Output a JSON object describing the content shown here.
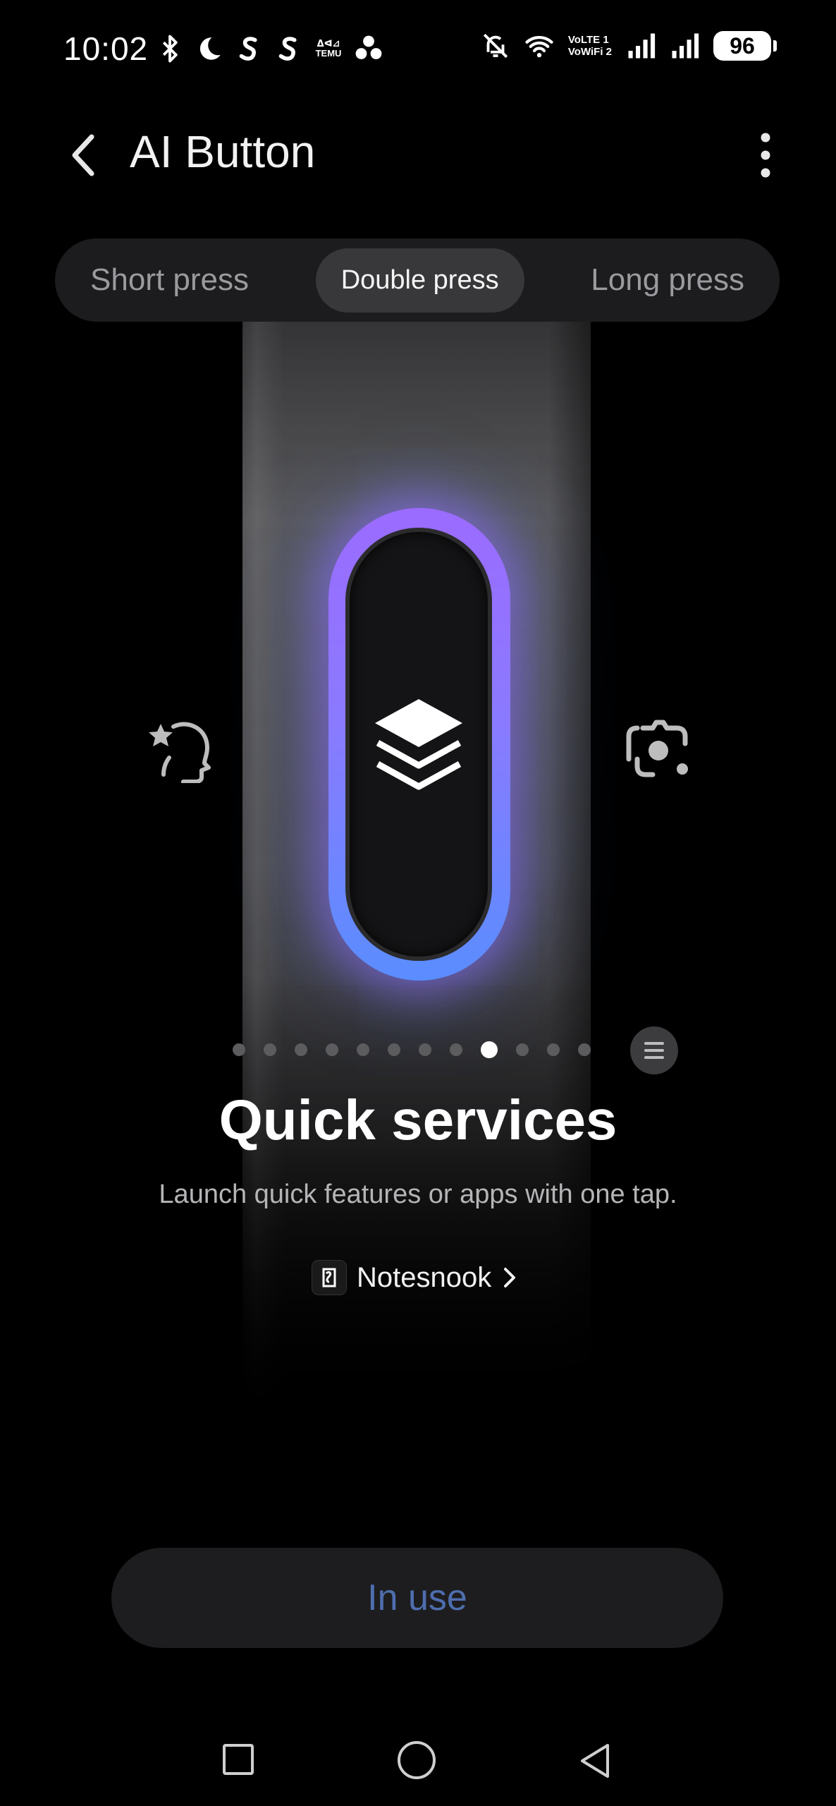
{
  "status_bar": {
    "time": "10:02",
    "left_icons": [
      "bluetooth-icon",
      "moon-icon",
      "s-app-icon",
      "s-app-icon",
      "temu-icon",
      "dots-app-icon"
    ],
    "temu_label": "ᐃᐊ⊿ TEMU",
    "right_icons": [
      "bell-off-icon",
      "wifi-icon",
      "volte-icon",
      "signal-icon",
      "signal-icon"
    ],
    "volte_top": "VoLTE 1",
    "volte_bottom": "VoWiFi 2",
    "battery": "96"
  },
  "header": {
    "title": "AI Button"
  },
  "tabs": [
    {
      "label": "Short press",
      "active": false
    },
    {
      "label": "Double press",
      "active": true
    },
    {
      "label": "Long press",
      "active": false
    }
  ],
  "carousel": {
    "total": 12,
    "active_index": 8,
    "center_icon": "layers-icon",
    "left_icon": "ai-head-icon",
    "right_icon": "camera-scan-icon",
    "glow_colors": [
      "#9b6bff",
      "#5a8dff"
    ]
  },
  "feature": {
    "title": "Quick services",
    "description": "Launch quick features or apps with one tap.",
    "app_name": "Notesnook"
  },
  "actions": {
    "in_use_label": "In use"
  },
  "colors": {
    "accent_text": "#4e6eaf",
    "tab_bg": "#1c1c1e",
    "tab_active_bg": "#38383a"
  }
}
